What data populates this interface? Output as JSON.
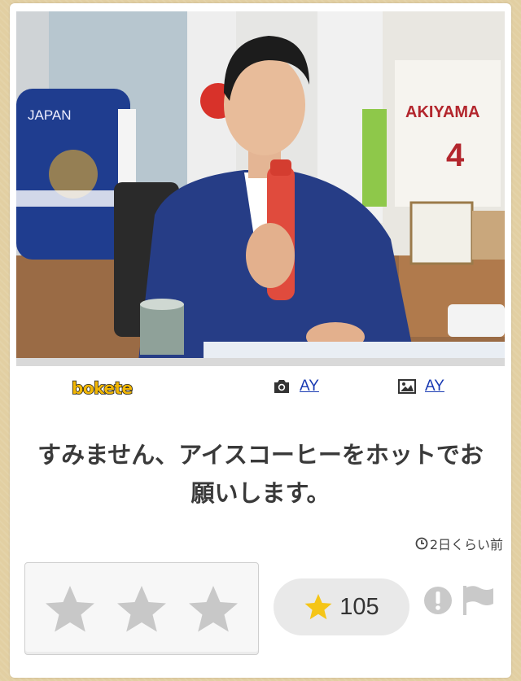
{
  "brand": {
    "logo_text": "bokete"
  },
  "credits": {
    "photo_author": "AY",
    "caption_author": "AY"
  },
  "post": {
    "caption": "すみません、アイスコーヒーをホットでお願いします。",
    "posted_time": "2日くらい前"
  },
  "rating": {
    "star_count": 3,
    "score": "105"
  },
  "icons": {
    "camera": "camera-icon",
    "image": "image-icon",
    "clock": "clock-icon",
    "star": "star-icon",
    "report": "exclamation-icon",
    "flag": "flag-icon"
  },
  "colors": {
    "background": "#e2cfa2",
    "link": "#1a3bb3",
    "gold_star": "#f5c518",
    "gray_star": "#c8c8c8"
  }
}
